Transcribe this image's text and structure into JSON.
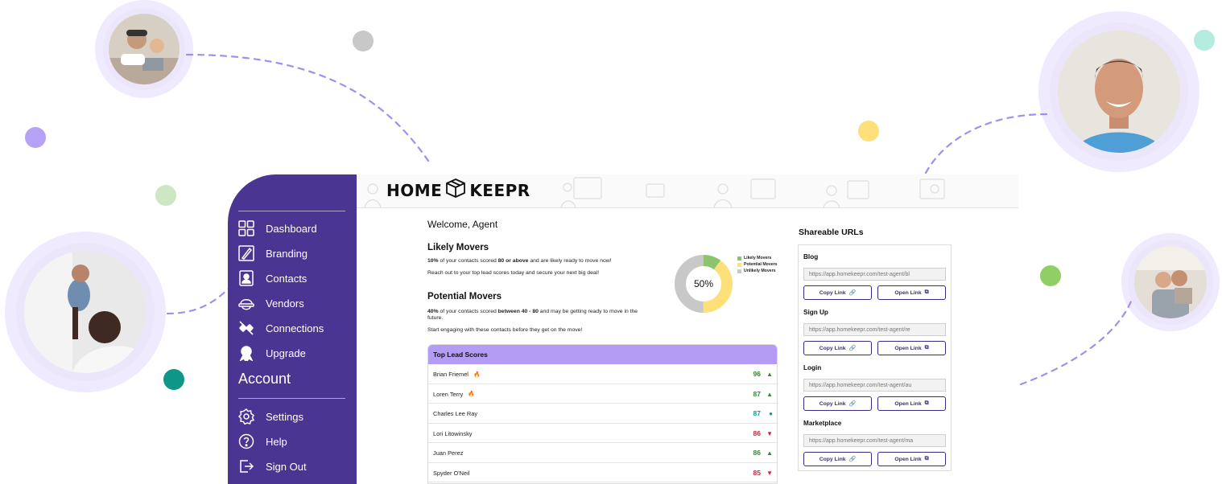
{
  "brand": {
    "logo_left": "HOME",
    "logo_right": "KEEPR",
    "accent": "#4a3592",
    "accent_light": "#b49cf4"
  },
  "sidebar": {
    "items": [
      {
        "label": "Dashboard",
        "icon": "grid-icon"
      },
      {
        "label": "Branding",
        "icon": "brush-icon"
      },
      {
        "label": "Contacts",
        "icon": "contact-card-icon"
      },
      {
        "label": "Vendors",
        "icon": "hard-hat-icon"
      },
      {
        "label": "Connections",
        "icon": "plug-icon"
      },
      {
        "label": "Upgrade",
        "icon": "award-icon"
      }
    ],
    "account_heading": "Account",
    "account_items": [
      {
        "label": "Settings",
        "icon": "gear-icon"
      },
      {
        "label": "Help",
        "icon": "help-icon"
      },
      {
        "label": "Sign Out",
        "icon": "sign-out-icon"
      }
    ]
  },
  "main": {
    "welcome": "Welcome, Agent",
    "likely": {
      "title": "Likely Movers",
      "pct": "10%",
      "text_a": " of your contacts scored ",
      "threshold": "80 or above",
      "text_b": " and are likely ready to move now!",
      "sub": "Reach out to your top lead scores today and secure your next big deal!"
    },
    "potential": {
      "title": "Potential Movers",
      "pct": "40%",
      "text_a": " of your contacts scored ",
      "threshold": "between 40 - 80",
      "text_b": " and may be getting ready to move in the future.",
      "sub": "Start engaging with these contacts before they get on the move!"
    },
    "donut": {
      "center_label": "50%",
      "segments": [
        {
          "name": "Likely Movers",
          "value": 10,
          "color": "#8cc46d"
        },
        {
          "name": "Potential Movers",
          "value": 40,
          "color": "#fde07a"
        },
        {
          "name": "Unlikely Movers",
          "value": 50,
          "color": "#c8c8c8"
        }
      ]
    },
    "leads": {
      "title": "Top Lead Scores",
      "rows": [
        {
          "name": "Brian Friemel",
          "hot": true,
          "score": "96",
          "trend": "up"
        },
        {
          "name": "Loren Terry",
          "hot": true,
          "score": "87",
          "trend": "up"
        },
        {
          "name": "Charles Lee Ray",
          "hot": false,
          "score": "87",
          "trend": "flat"
        },
        {
          "name": "Lori Litowinsky",
          "hot": false,
          "score": "86",
          "trend": "down"
        },
        {
          "name": "Juan Perez",
          "hot": false,
          "score": "86",
          "trend": "up"
        },
        {
          "name": "Spyder O'Neil",
          "hot": false,
          "score": "85",
          "trend": "down"
        }
      ]
    }
  },
  "share": {
    "title": "Shareable URLs",
    "copy_label": "Copy Link",
    "open_label": "Open Link",
    "items": [
      {
        "label": "Blog",
        "url": "https://app.homekeepr.com/test-agent/bl"
      },
      {
        "label": "Sign Up",
        "url": "https://app.homekeepr.com/test-agent/re"
      },
      {
        "label": "Login",
        "url": "https://app.homekeepr.com/test-agent/au"
      },
      {
        "label": "Marketplace",
        "url": "https://app.homekeepr.com/test-agent/ma"
      }
    ]
  },
  "colors": {
    "up": "#2e8b2e",
    "down": "#cc1f3a",
    "flat": "#14968a"
  }
}
